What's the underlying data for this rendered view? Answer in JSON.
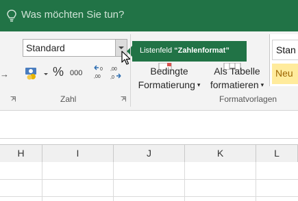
{
  "tell_me": {
    "placeholder": "Was möchten Sie tun?"
  },
  "number_format": {
    "value": "Standard",
    "tooltip_prefix": "Listenfeld ",
    "tooltip_name": "“Zahlenformat”"
  },
  "number_group": {
    "percent": "%",
    "thousands": "000",
    "label": "Zahl"
  },
  "styles_group": {
    "conditional_line1": "Bedingte",
    "conditional_line2": "Formatierung",
    "table_line1": "Als Tabelle",
    "table_line2": "formatieren",
    "label": "Formatvorlagen",
    "cell_style_standard": "Stan",
    "cell_style_neutral": "Neu"
  },
  "columns": [
    "H",
    "I",
    "J",
    "K",
    "L"
  ],
  "colors": {
    "excel_green": "#217346",
    "neutral_fill": "#ffeb9c"
  }
}
